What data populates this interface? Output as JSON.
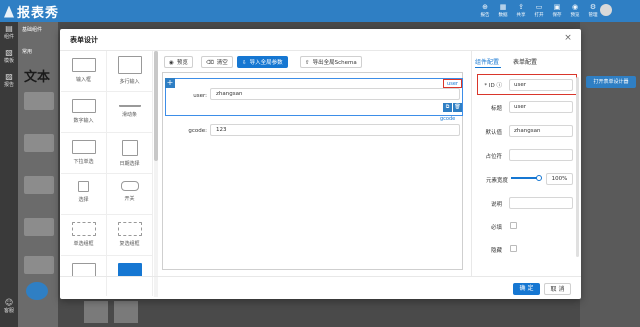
{
  "app": {
    "logo_text": "报表秀",
    "header_icons": [
      {
        "icon": "report-icon",
        "label": "报告"
      },
      {
        "icon": "data-icon",
        "label": "数据"
      },
      {
        "icon": "share-icon",
        "label": "共享"
      },
      {
        "icon": "open-icon",
        "label": "打开"
      },
      {
        "icon": "save-icon",
        "label": "保存"
      },
      {
        "icon": "preview-icon",
        "label": "预览"
      },
      {
        "icon": "manage-icon",
        "label": "管理"
      }
    ],
    "rail": [
      {
        "icon": "component-icon",
        "label": "组件"
      },
      {
        "icon": "template-icon",
        "label": "模板"
      },
      {
        "icon": "report-icon",
        "label": "报告"
      },
      {
        "icon": "service-icon",
        "label": "客服"
      }
    ],
    "palette": {
      "tab": "基础组件",
      "section": "常用",
      "text_item": "文本"
    },
    "behind_button": "打开表单设计器"
  },
  "modal": {
    "title": "表单设计",
    "widgets": [
      {
        "icon": "input-icon",
        "label": "输入框"
      },
      {
        "icon": "textarea-icon",
        "label": "多行输入"
      },
      {
        "icon": "number-icon",
        "label": "数字输入"
      },
      {
        "icon": "slider-icon",
        "label": "滑动条"
      },
      {
        "icon": "select-icon",
        "label": "下拉单选"
      },
      {
        "icon": "date-icon",
        "label": "日期选择"
      },
      {
        "icon": "checkbox-icon",
        "label": "选择"
      },
      {
        "icon": "switch-icon",
        "label": "开关"
      },
      {
        "icon": "radio-group-icon",
        "label": "单选组框"
      },
      {
        "icon": "checkbox-group-icon",
        "label": "复选组框"
      }
    ],
    "toolbar": {
      "preview": "预览",
      "clear": "清空",
      "import_params": "导入全局参数",
      "export_schema": "导出全局Schema"
    },
    "form": {
      "fields": [
        {
          "label": "user:",
          "value": "zhangsan",
          "tag": "user"
        },
        {
          "label": "gcode:",
          "value": "123",
          "tag": "gcode"
        }
      ]
    },
    "config": {
      "tab_component": "组件配置",
      "tab_form": "表单配置",
      "id_label": "* ID",
      "id_value": "user",
      "title_label": "标题",
      "title_value": "user",
      "default_label": "默认值",
      "default_value": "zhangsan",
      "placeholder_label": "占位符",
      "placeholder_value": "",
      "width_label": "元素宽度",
      "width_value": "100%",
      "width_percent": 100,
      "desc_label": "说明",
      "desc_value": "",
      "required_label": "必填",
      "required_checked": false,
      "hidden_label": "隐藏",
      "hidden_checked": false
    },
    "footer": {
      "ok": "确 定",
      "cancel": "取 消"
    }
  },
  "colors": {
    "primary": "#1677d2",
    "header": "#2f7fc4",
    "highlight": "#d9362b"
  }
}
